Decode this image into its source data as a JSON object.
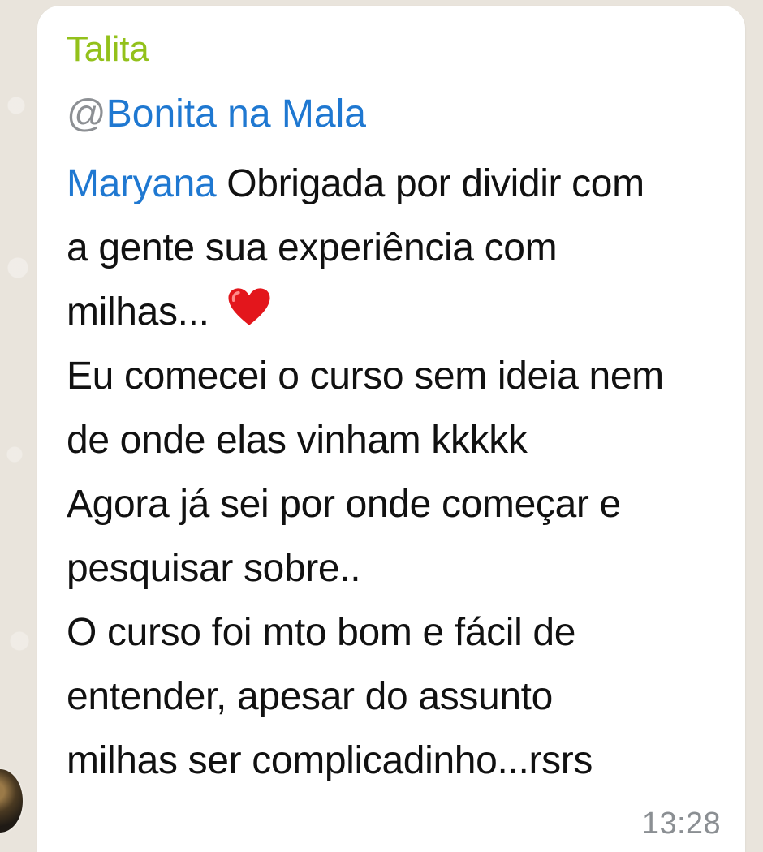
{
  "chat": {
    "sender_name": "Talita",
    "mention_prefix": "@",
    "mention_name": "Bonita na Mala",
    "message": {
      "line_1_mention": "Maryana",
      "line_1_text": " Obrigada por dividir com",
      "line_2": "a gente sua experiência com",
      "line_3_text": "milhas...",
      "line_3_emoji_icon": "heart-icon",
      "line_4": "Eu comecei o curso sem ideia nem",
      "line_5": "de onde elas vinham kkkkk",
      "line_6": "Agora já sei por onde começar e",
      "line_7": "pesquisar sobre..",
      "line_8": "O curso foi mto bom e fácil de",
      "line_9": "entender, apesar do assunto",
      "line_10": "milhas ser complicadinho...rsrs"
    },
    "timestamp": "13:28",
    "colors": {
      "background": "#e9e4dc",
      "bubble": "#ffffff",
      "sender": "#93c11b",
      "mention": "#1f78d1",
      "mention_at": "#8d9094",
      "text": "#111111",
      "timestamp": "#8b8f93",
      "heart": "#e3161c"
    }
  }
}
